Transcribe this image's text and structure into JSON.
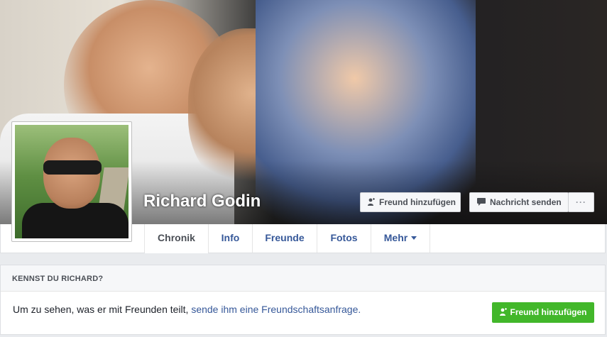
{
  "profile": {
    "name": "Richard Godin"
  },
  "actions": {
    "add_friend": "Freund hinzufügen",
    "send_message": "Nachricht senden",
    "more_dots": "···"
  },
  "tabs": [
    {
      "label": "Chronik"
    },
    {
      "label": "Info"
    },
    {
      "label": "Freunde"
    },
    {
      "label": "Fotos"
    },
    {
      "label": "Mehr"
    }
  ],
  "know_card": {
    "header": "KENNST DU RICHARD?",
    "text": "Um zu sehen, was er mit Freunden teilt, ",
    "link": "sende ihm eine Freundschaftsanfrage",
    "link_suffix": ".",
    "button": "Freund hinzufügen"
  },
  "colors": {
    "link": "#365899",
    "green": "#42b72a"
  },
  "icons": [
    "add-friend-icon",
    "message-icon",
    "caret-down-icon"
  ]
}
